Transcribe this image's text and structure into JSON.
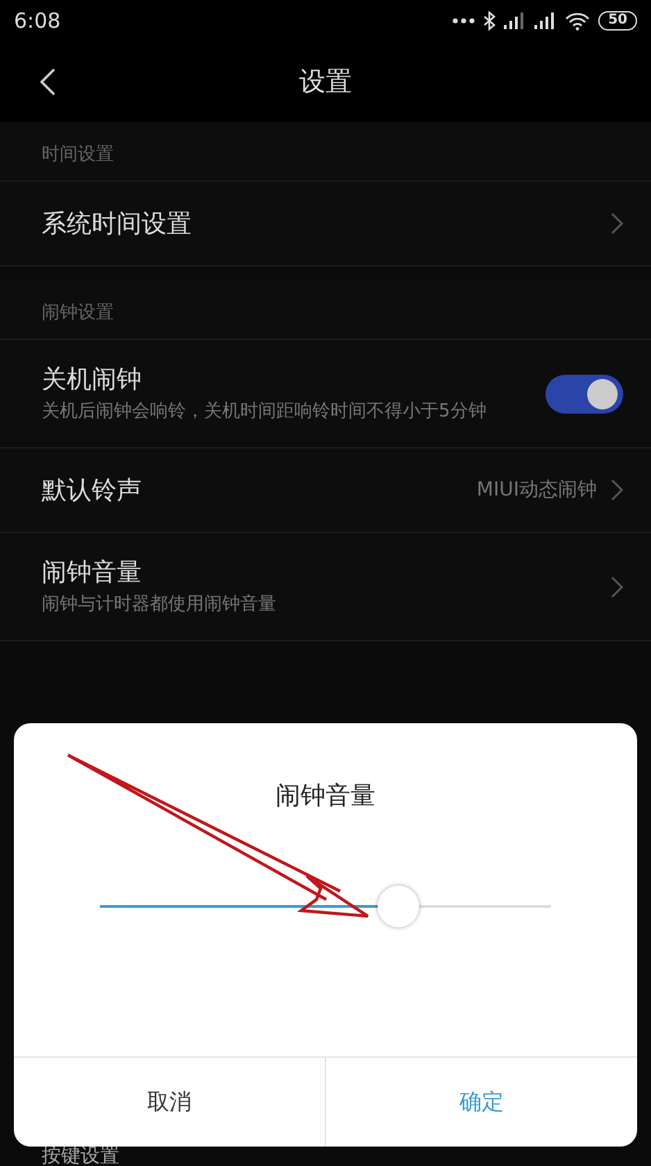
{
  "status_bar": {
    "time": "6:08",
    "battery": "50"
  },
  "header": {
    "title": "设置"
  },
  "sections": [
    {
      "title": "时间设置",
      "items": [
        {
          "kind": "link",
          "title": "系统时间设置"
        }
      ]
    },
    {
      "title": "闹钟设置",
      "items": [
        {
          "kind": "toggle",
          "title": "关机闹钟",
          "subtitle": "关机后闹钟会响铃，关机时间距响铃时间不得小于5分钟",
          "on": true
        },
        {
          "kind": "link",
          "title": "默认铃声",
          "value": "MIUI动态闹钟"
        },
        {
          "kind": "link",
          "title": "闹钟音量",
          "subtitle": "闹钟与计时器都使用闹钟音量"
        }
      ]
    }
  ],
  "behind_row": "按键设置",
  "dialog": {
    "title": "闹钟音量",
    "slider": {
      "level": 0.66
    },
    "buttons": [
      {
        "label": "取消",
        "kind": "cancel"
      },
      {
        "label": "确定",
        "kind": "confirm"
      }
    ]
  }
}
